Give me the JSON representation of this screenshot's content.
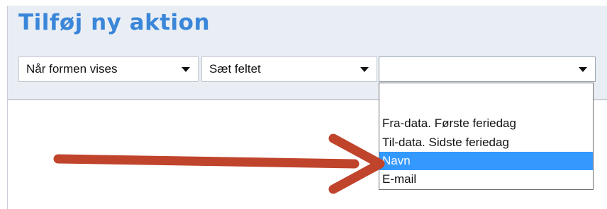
{
  "title": "Tilføj ny aktion",
  "selects": {
    "trigger": {
      "value": "Når formen vises"
    },
    "action": {
      "value": "Sæt feltet"
    },
    "field": {
      "value": ""
    }
  },
  "dropdown": {
    "options": [
      {
        "label": ""
      },
      {
        "label": "Fra-data. Første feriedag"
      },
      {
        "label": "Til-data. Sidste feriedag"
      },
      {
        "label": "Navn",
        "selected": true
      },
      {
        "label": "E-mail"
      }
    ]
  },
  "colors": {
    "title": "#3a86d8",
    "header_bg": "#e9eef5",
    "highlight": "#3399ff",
    "annotation_arrow": "#c0442c"
  },
  "icons": [
    "chevron-down-icon",
    "annotation-arrow"
  ]
}
